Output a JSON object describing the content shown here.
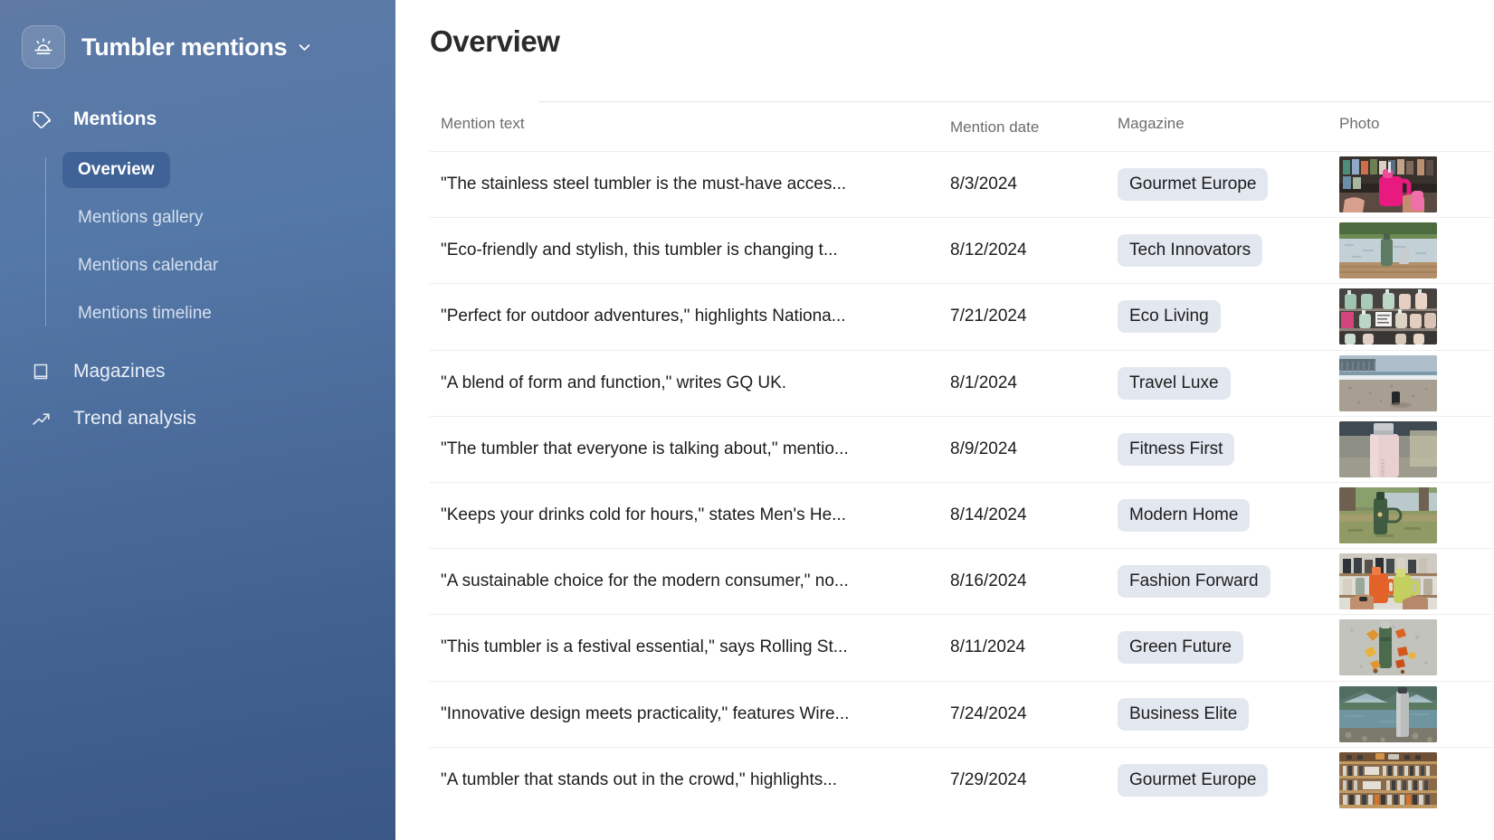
{
  "sidebar": {
    "logo_icon": "sunrise-icon",
    "brand_title": "Tumbler mentions",
    "brand_caret_icon": "chevron-down-icon",
    "group": {
      "icon": "tag-icon",
      "label": "Mentions",
      "subitems": [
        {
          "label": "Overview",
          "active": true
        },
        {
          "label": "Mentions gallery",
          "active": false
        },
        {
          "label": "Mentions calendar",
          "active": false
        },
        {
          "label": "Mentions timeline",
          "active": false
        }
      ]
    },
    "items": [
      {
        "icon": "book-icon",
        "label": "Magazines"
      },
      {
        "icon": "trending-up-icon",
        "label": "Trend analysis"
      }
    ]
  },
  "main": {
    "page_title": "Overview",
    "table": {
      "columns": [
        {
          "key": "text",
          "label": "Mention text"
        },
        {
          "key": "date",
          "label": "Mention date"
        },
        {
          "key": "magazine",
          "label": "Magazine"
        },
        {
          "key": "photo",
          "label": "Photo"
        }
      ],
      "rows": [
        {
          "text": "\"The stainless steel tumbler is the must-have acces...",
          "date": "8/3/2024",
          "magazine": "Gourmet Europe",
          "photo_alt": "pink-tumbler-in-store-held-by-hand"
        },
        {
          "text": "\"Eco-friendly and stylish, this tumbler is changing t...",
          "date": "8/12/2024",
          "magazine": "Tech Innovators",
          "photo_alt": "green-bottle-and-cup-on-dock-by-lake"
        },
        {
          "text": "\"Perfect for outdoor adventures,\" highlights Nationa...",
          "date": "7/21/2024",
          "magazine": "Eco Living",
          "photo_alt": "retail-shelf-display-of-pastel-tumblers"
        },
        {
          "text": "\"A blend of form and function,\" writes GQ UK.",
          "date": "8/1/2024",
          "magazine": "Travel Luxe",
          "photo_alt": "dark-tumbler-on-beach-with-pier"
        },
        {
          "text": "\"The tumbler that everyone is talking about,\" mentio...",
          "date": "8/9/2024",
          "magazine": "Fitness First",
          "photo_alt": "pink-stanley-bottle-closeup"
        },
        {
          "text": "\"Keeps your drinks cold for hours,\" states Men's He...",
          "date": "8/14/2024",
          "magazine": "Modern Home",
          "photo_alt": "green-thermos-by-tree-and-river"
        },
        {
          "text": "\"A sustainable choice for the modern consumer,\" no...",
          "date": "8/16/2024",
          "magazine": "Fashion Forward",
          "photo_alt": "two-hands-holding-orange-and-green-tumblers-in-shop"
        },
        {
          "text": "\"This tumbler is a festival essential,\" says Rolling St...",
          "date": "8/11/2024",
          "magazine": "Green Future",
          "photo_alt": "green-thermos-with-autumn-leaves-on-concrete"
        },
        {
          "text": "\"Innovative design meets practicality,\" features Wire...",
          "date": "7/24/2024",
          "magazine": "Business Elite",
          "photo_alt": "steel-thermos-in-front-of-mountain-lake"
        },
        {
          "text": "\"A tumbler that stands out in the crowd,\" highlights...",
          "date": "7/29/2024",
          "magazine": "Gourmet Europe",
          "photo_alt": "wooden-shelves-of-bottles-in-store"
        }
      ]
    }
  },
  "colors": {
    "sidebar_top": "#5e7aa5",
    "sidebar_bottom": "#3a5785",
    "active_pill": "#3f6396",
    "badge_bg": "#e3e8f0",
    "text_primary": "#1c1c1c",
    "text_muted": "#6d6d6d"
  }
}
